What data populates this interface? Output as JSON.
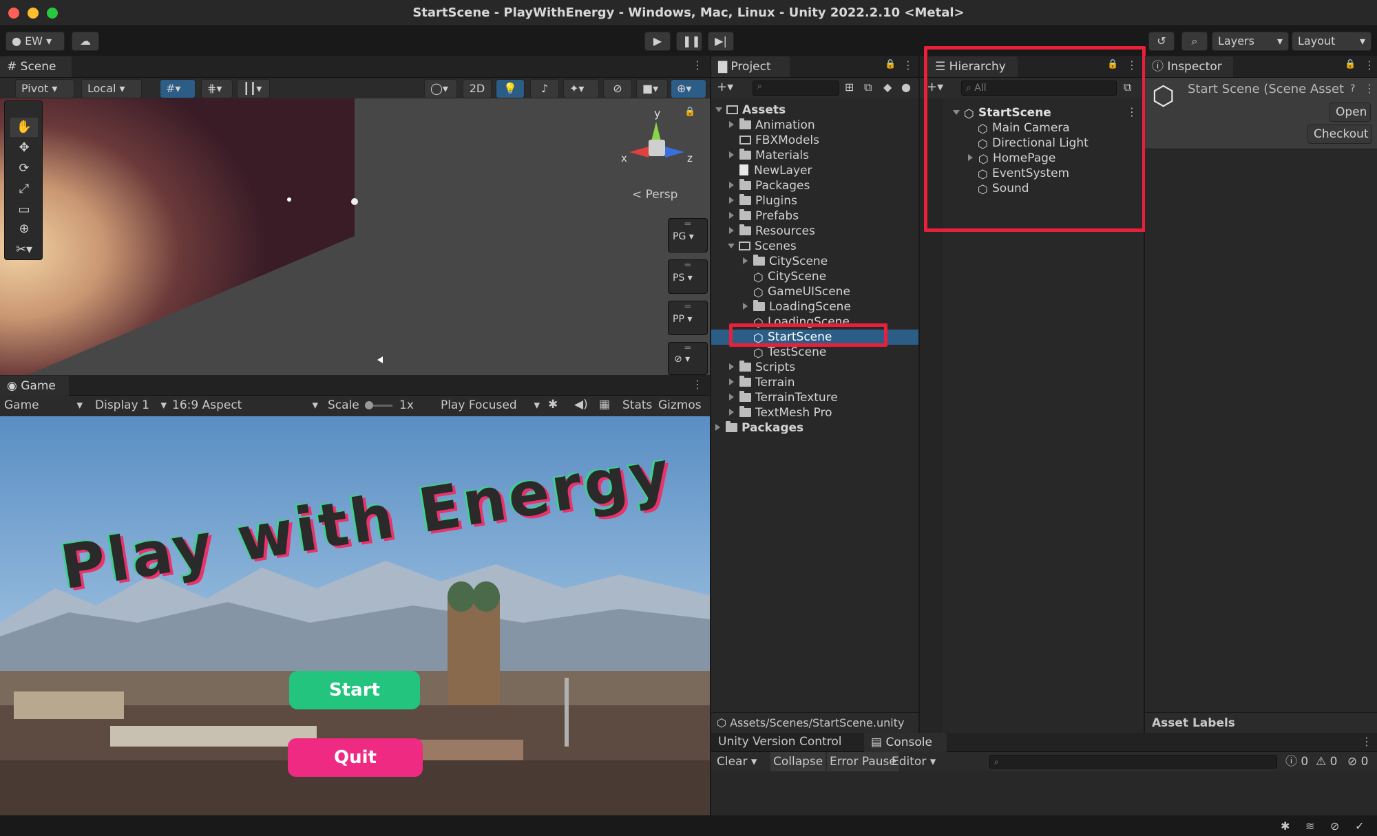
{
  "window": {
    "title": "StartScene - PlayWithEnergy - Windows, Mac, Linux - Unity 2022.2.10 <Metal>"
  },
  "toolbar": {
    "account": "EW",
    "layers": "Layers",
    "layout": "Layout",
    "play_icon": "play-icon",
    "pause_icon": "pause-icon",
    "step_icon": "step-icon"
  },
  "scene": {
    "tab": "Scene",
    "pivot": "Pivot",
    "local": "Local",
    "two_d": "2D",
    "persp": "Persp",
    "axis_y": "y",
    "axis_x": "x",
    "axis_z": "z",
    "overlays": [
      "PG",
      "PS",
      "PP"
    ]
  },
  "game": {
    "tab": "Game",
    "mode": "Game",
    "display": "Display 1",
    "aspect": "16:9 Aspect",
    "scale_label": "Scale",
    "scale_value": "1x",
    "play_focused": "Play Focused",
    "stats": "Stats",
    "gizmos": "Gizmos",
    "title_art": "Play with Energy",
    "start": "Start",
    "quit": "Quit"
  },
  "project": {
    "tab": "Project",
    "assets": "Assets",
    "items": [
      {
        "label": "Animation",
        "kind": "folder"
      },
      {
        "label": "FBXModels",
        "kind": "folder"
      },
      {
        "label": "Materials",
        "kind": "folder"
      },
      {
        "label": "NewLayer",
        "kind": "file"
      },
      {
        "label": "Packages",
        "kind": "folder"
      },
      {
        "label": "Plugins",
        "kind": "folder"
      },
      {
        "label": "Prefabs",
        "kind": "folder"
      },
      {
        "label": "Resources",
        "kind": "folder"
      },
      {
        "label": "Scenes",
        "kind": "folder-open"
      }
    ],
    "scenes": [
      {
        "label": "CityScene",
        "kind": "folder"
      },
      {
        "label": "CityScene",
        "kind": "scene"
      },
      {
        "label": "GameUIScene",
        "kind": "scene"
      },
      {
        "label": "LoadingScene",
        "kind": "folder"
      },
      {
        "label": "LoadingScene",
        "kind": "scene"
      },
      {
        "label": "StartScene",
        "kind": "scene",
        "selected": true
      },
      {
        "label": "TestScene",
        "kind": "scene"
      }
    ],
    "items2": [
      {
        "label": "Scripts"
      },
      {
        "label": "Terrain"
      },
      {
        "label": "TerrainTexture"
      },
      {
        "label": "TextMesh Pro"
      }
    ],
    "packages": "Packages",
    "path": "Assets/Scenes/StartScene.unity"
  },
  "hierarchy": {
    "tab": "Hierarchy",
    "search_placeholder": "All",
    "root": "StartScene",
    "items": [
      "Main Camera",
      "Directional Light",
      "HomePage",
      "EventSystem",
      "Sound"
    ]
  },
  "inspector": {
    "tab": "Inspector",
    "title": "Start Scene (Scene Asset",
    "open": "Open",
    "checkout": "Checkout",
    "asset_labels": "Asset Labels"
  },
  "console": {
    "tab_vc": "Unity Version Control",
    "tab_console": "Console",
    "clear": "Clear",
    "collapse": "Collapse",
    "error_pause": "Error Pause",
    "editor": "Editor",
    "info_count": "0",
    "warn_count": "0",
    "error_count": "0"
  },
  "colors": {
    "highlight": "#e8203a",
    "selection": "#2c5d87",
    "start_btn": "#22c47e",
    "quit_btn": "#ee2a82"
  }
}
